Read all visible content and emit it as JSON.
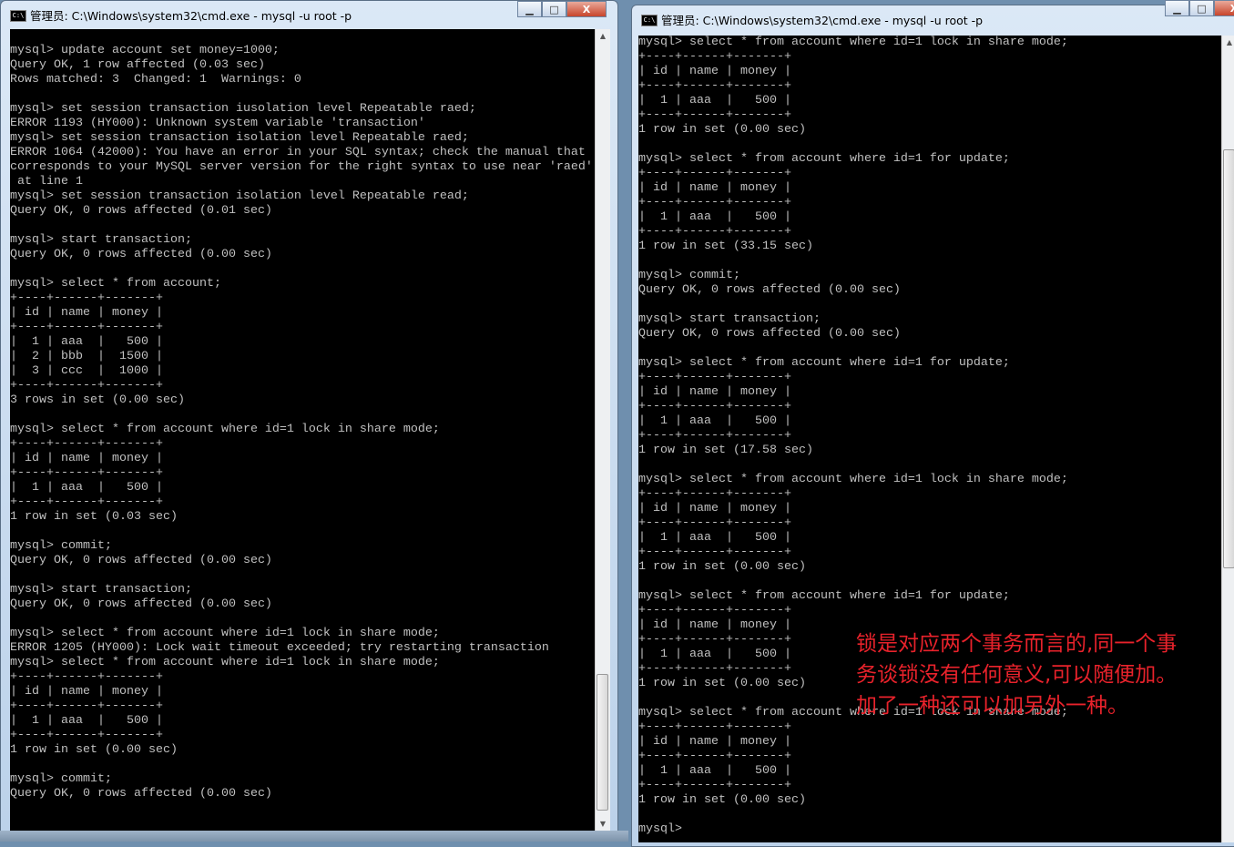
{
  "left_window": {
    "title": "管理员: C:\\Windows\\system32\\cmd.exe - mysql  -u root -p",
    "controls": {
      "minimize": "▁",
      "maximize": "□",
      "close": "X"
    },
    "lines": [
      "",
      "mysql> update account set money=1000;",
      "Query OK, 1 row affected (0.03 sec)",
      "Rows matched: 3  Changed: 1  Warnings: 0",
      "",
      "mysql> set session transaction iusolation level Repeatable raed;",
      "ERROR 1193 (HY000): Unknown system variable 'transaction'",
      "mysql> set session transaction isolation level Repeatable raed;",
      "ERROR 1064 (42000): You have an error in your SQL syntax; check the manual that",
      "corresponds to your MySQL server version for the right syntax to use near 'raed'",
      " at line 1",
      "mysql> set session transaction isolation level Repeatable read;",
      "Query OK, 0 rows affected (0.01 sec)",
      "",
      "mysql> start transaction;",
      "Query OK, 0 rows affected (0.00 sec)",
      "",
      "mysql> select * from account;",
      "+----+------+-------+",
      "| id | name | money |",
      "+----+------+-------+",
      "|  1 | aaa  |   500 |",
      "|  2 | bbb  |  1500 |",
      "|  3 | ccc  |  1000 |",
      "+----+------+-------+",
      "3 rows in set (0.00 sec)",
      "",
      "mysql> select * from account where id=1 lock in share mode;",
      "+----+------+-------+",
      "| id | name | money |",
      "+----+------+-------+",
      "|  1 | aaa  |   500 |",
      "+----+------+-------+",
      "1 row in set (0.03 sec)",
      "",
      "mysql> commit;",
      "Query OK, 0 rows affected (0.00 sec)",
      "",
      "mysql> start transaction;",
      "Query OK, 0 rows affected (0.00 sec)",
      "",
      "mysql> select * from account where id=1 lock in share mode;",
      "ERROR 1205 (HY000): Lock wait timeout exceeded; try restarting transaction",
      "mysql> select * from account where id=1 lock in share mode;",
      "+----+------+-------+",
      "| id | name | money |",
      "+----+------+-------+",
      "|  1 | aaa  |   500 |",
      "+----+------+-------+",
      "1 row in set (0.00 sec)",
      "",
      "mysql> commit;",
      "Query OK, 0 rows affected (0.00 sec)",
      "",
      "",
      "mysql> "
    ]
  },
  "right_window": {
    "title": "管理员: C:\\Windows\\system32\\cmd.exe - mysql  -u root -p",
    "controls": {
      "minimize": "▁",
      "maximize": "□",
      "close": "X"
    },
    "lines": [
      "mysql> select * from account where id=1 lock in share mode;",
      "+----+------+-------+",
      "| id | name | money |",
      "+----+------+-------+",
      "|  1 | aaa  |   500 |",
      "+----+------+-------+",
      "1 row in set (0.00 sec)",
      "",
      "mysql> select * from account where id=1 for update;",
      "+----+------+-------+",
      "| id | name | money |",
      "+----+------+-------+",
      "|  1 | aaa  |   500 |",
      "+----+------+-------+",
      "1 row in set (33.15 sec)",
      "",
      "mysql> commit;",
      "Query OK, 0 rows affected (0.00 sec)",
      "",
      "mysql> start transaction;",
      "Query OK, 0 rows affected (0.00 sec)",
      "",
      "mysql> select * from account where id=1 for update;",
      "+----+------+-------+",
      "| id | name | money |",
      "+----+------+-------+",
      "|  1 | aaa  |   500 |",
      "+----+------+-------+",
      "1 row in set (17.58 sec)",
      "",
      "mysql> select * from account where id=1 lock in share mode;",
      "+----+------+-------+",
      "| id | name | money |",
      "+----+------+-------+",
      "|  1 | aaa  |   500 |",
      "+----+------+-------+",
      "1 row in set (0.00 sec)",
      "",
      "mysql> select * from account where id=1 for update;",
      "+----+------+-------+",
      "| id | name | money |",
      "+----+------+-------+",
      "|  1 | aaa  |   500 |",
      "+----+------+-------+",
      "1 row in set (0.00 sec)",
      "",
      "mysql> select * from account where id=1 lock in share mode;",
      "+----+------+-------+",
      "| id | name | money |",
      "+----+------+-------+",
      "|  1 | aaa  |   500 |",
      "+----+------+-------+",
      "1 row in set (0.00 sec)",
      "",
      "mysql> "
    ]
  },
  "annotation": {
    "color": "#e8222b",
    "lines": [
      "锁是对应两个事务而言的,同一个事",
      "务谈锁没有任何意义,可以随便加。",
      "加了一种还可以加另外一种。"
    ]
  },
  "colors": {
    "console_bg": "#000000",
    "console_text": "#c0c0c0"
  }
}
